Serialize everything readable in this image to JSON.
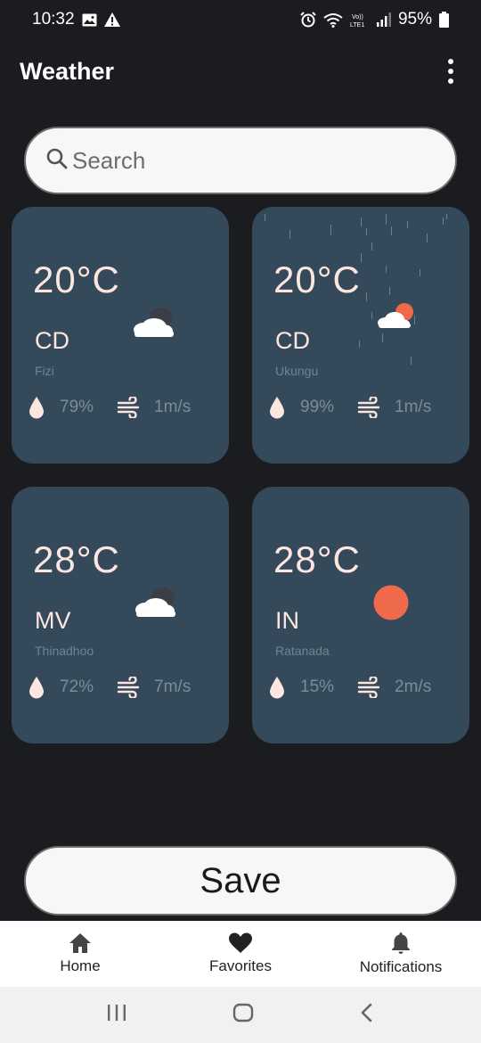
{
  "status_bar": {
    "time": "10:32",
    "battery": "95%",
    "icons": [
      "image-icon",
      "warning-icon",
      "alarm-icon",
      "wifi-icon",
      "volte-icon",
      "signal-icon",
      "battery-icon"
    ]
  },
  "app_bar": {
    "title": "Weather",
    "menu_icon": "more-vert-icon"
  },
  "search": {
    "placeholder": "Search",
    "value": "",
    "icon": "search-icon"
  },
  "cards": [
    {
      "temp": "20°C",
      "country": "CD",
      "city": "Fizi",
      "humidity": "79%",
      "wind": "1m/s",
      "icon": "cloudy-night-icon"
    },
    {
      "temp": "20°C",
      "country": "CD",
      "city": "Ukungu",
      "humidity": "99%",
      "wind": "1m/s",
      "icon": "partly-cloudy-rain-icon"
    },
    {
      "temp": "28°C",
      "country": "MV",
      "city": "Thinadhoo",
      "humidity": "72%",
      "wind": "7m/s",
      "icon": "cloudy-night-icon"
    },
    {
      "temp": "28°C",
      "country": "IN",
      "city": "Ratanada",
      "humidity": "15%",
      "wind": "2m/s",
      "icon": "sun-icon"
    }
  ],
  "save_button": {
    "label": "Save"
  },
  "bottom_nav": [
    {
      "label": "Home",
      "icon": "home-icon"
    },
    {
      "label": "Favorites",
      "icon": "heart-icon"
    },
    {
      "label": "Notifications",
      "icon": "bell-icon"
    }
  ],
  "system_nav": [
    "recents-icon",
    "home-circle-icon",
    "back-icon"
  ],
  "colors": {
    "background": "#1b1c1f",
    "card": "#34495a",
    "text_light": "#fde6df",
    "text_muted": "#7a8d99",
    "sun": "#ee6a4a",
    "button_bg": "#f7f7f7"
  }
}
